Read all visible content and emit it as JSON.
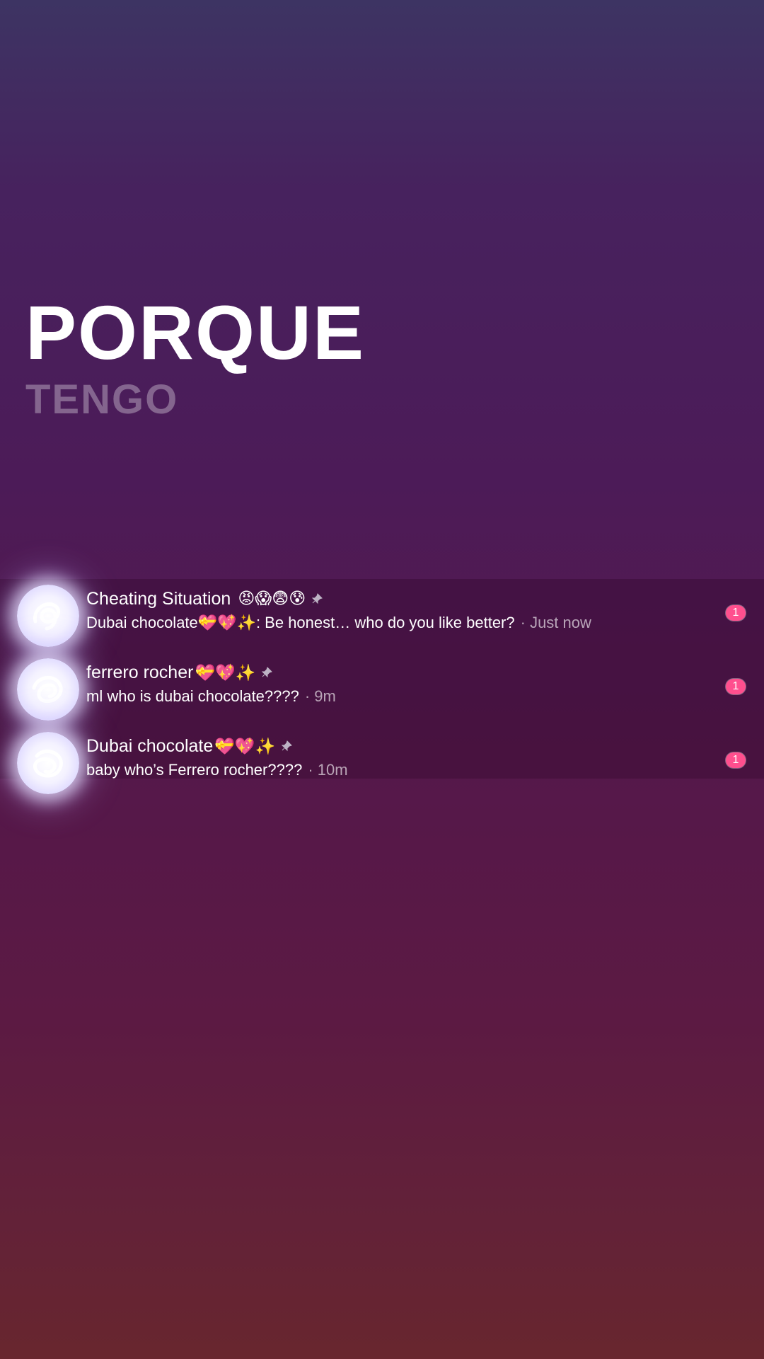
{
  "lyrics": {
    "main": "PORQUE",
    "sub": "TENGO"
  },
  "chats": [
    {
      "title": "Cheating Situation",
      "title_emoji": "😡😱😨😰",
      "preview": "Dubai chocolate💝💖✨: Be honest… who do you like better?",
      "time": "· Just now",
      "unread": "1",
      "pinned_icon": "pin-icon"
    },
    {
      "title": "ferrero rocher",
      "title_emoji": "💝💖✨",
      "preview": "ml who is dubai chocolate????",
      "time": "· 9m",
      "unread": "1",
      "pinned_icon": "pin-icon"
    },
    {
      "title": "Dubai chocolate",
      "title_emoji": "💝💖✨",
      "preview": "baby who’s Ferrero rocher????",
      "time": "· 10m",
      "unread": "1",
      "pinned_icon": "pin-icon"
    }
  ],
  "colors": {
    "badge": "#ff4f8e",
    "avatar_glow": "#e8e2ff"
  }
}
